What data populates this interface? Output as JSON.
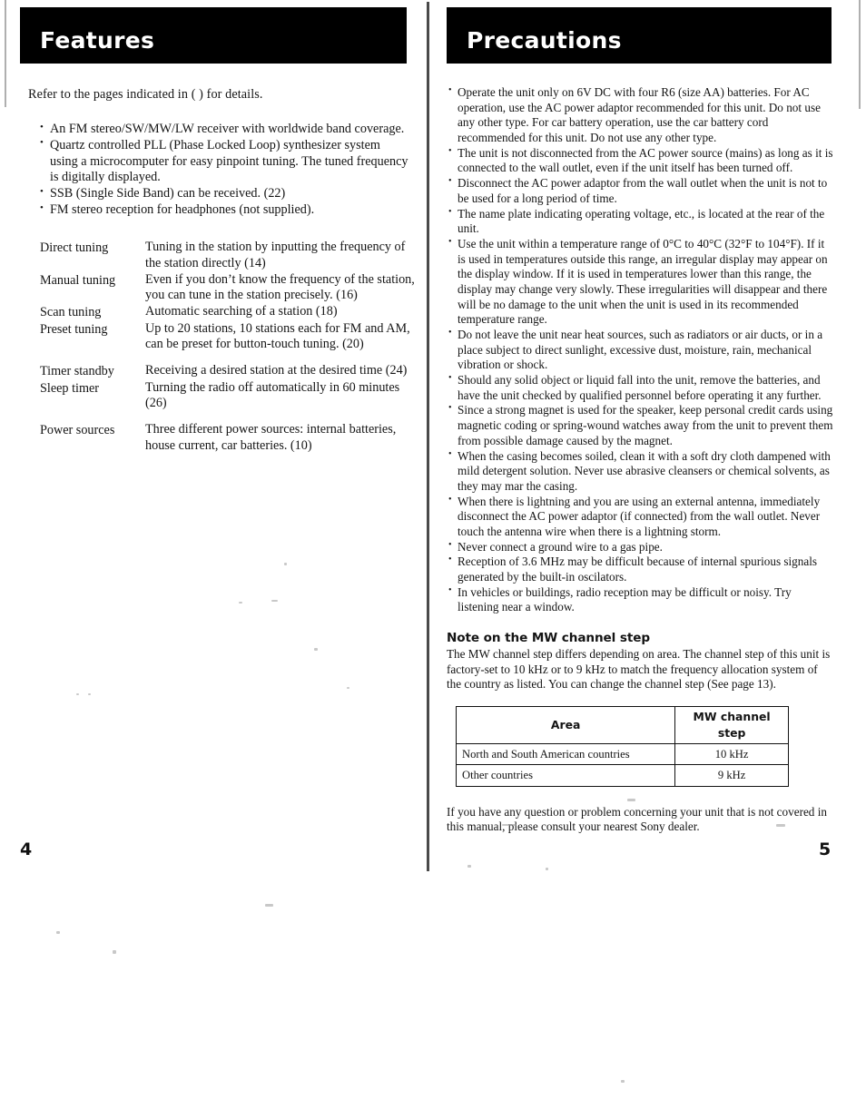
{
  "document": {
    "left_page_number": "4",
    "right_page_number": "5"
  },
  "left_column": {
    "section_title": "Features",
    "intro": "Refer to the pages indicated in ( ) for details.",
    "feature_bullets": [
      "An FM stereo/SW/MW/LW receiver with worldwide band coverage.",
      "Quartz controlled PLL (Phase Locked Loop) synthesizer system using a microcomputer for easy pinpoint tuning.  The tuned frequency is digitally displayed.",
      "SSB (Single Side Band) can be received. (22)",
      "FM stereo reception for headphones (not supplied)."
    ],
    "definitions": [
      {
        "term": "Direct tuning",
        "desc": "Tuning in the station by inputting the frequency of the station directly (14)"
      },
      {
        "term": "Manual tuning",
        "desc": "Even if you don’t know the frequency of the station, you can tune in the station precisely. (16)"
      },
      {
        "term": "Scan tuning",
        "desc": "Automatic searching of a station (18)"
      },
      {
        "term": "Preset tuning",
        "desc": "Up to 20 stations, 10 stations each for FM and AM, can be preset for button-touch tuning. (20)"
      },
      {
        "term": "Timer standby",
        "desc": "Receiving a desired station at the desired time (24)"
      },
      {
        "term": "Sleep timer",
        "desc": "Turning the radio off automatically in 60 minutes (26)"
      },
      {
        "term": "Power sources",
        "desc": "Three different power sources: internal batteries, house current, car batteries. (10)"
      }
    ]
  },
  "right_column": {
    "section_title": "Precautions",
    "precaution_bullets": [
      "Operate the unit only on 6V DC with four R6 (size AA) batteries. For AC operation, use the AC power adaptor recommended for this unit. Do not use any other type. For car battery operation, use the car battery cord recommended for this unit.  Do not use any other type.",
      "The unit is not disconnected from the AC power source (mains) as long as it is connected to the wall outlet, even if the unit itself has been turned off.",
      "Disconnect the AC power adaptor from the wall outlet when the unit is not to be used for a long period of time.",
      "The name plate indicating operating voltage, etc., is located at the rear of the unit.",
      "Use the unit within a temperature range of 0°C to 40°C (32°F to 104°F).  If it is used in temperatures outside this range, an irregular display may appear on the display window.  If it is used in temperatures lower than this range, the display may change very slowly.  These irregularities will disappear and there will be no damage to the unit when the unit is used in its recommended temperature range.",
      "Do not leave the unit near heat sources, such as radiators or air ducts, or in a place subject to direct sunlight, excessive dust, moisture, rain, mechanical vibration or shock.",
      "Should any solid object or liquid fall into the unit, remove the batteries, and have the unit checked by qualified personnel before operating it any further.",
      "Since a strong magnet is used for the speaker, keep personal credit cards using magnetic coding or spring-wound watches away from the unit to prevent them from possible damage caused by the magnet.",
      "When the casing becomes soiled, clean it with a soft dry cloth dampened with mild detergent solution.  Never use abrasive cleansers or chemical solvents, as they may mar the casing.",
      "When there is lightning and you are using an external antenna, immediately disconnect the AC power adaptor (if connected) from the wall outlet.  Never touch the antenna wire when there is a lightning storm.",
      "Never connect a ground wire to a gas pipe.",
      "Reception of 3.6 MHz may be difficult because of internal spurious signals generated by the built-in oscilators.",
      "In vehicles or buildings, radio reception may be difficult or noisy.  Try listening near a window."
    ],
    "note_heading": "Note on the MW channel step",
    "note_paragraph": "The MW channel step differs depending on area.  The channel step of this unit is factory-set to 10 kHz or to 9 kHz to match the frequency allocation system of the country as listed.  You can change the channel step (See page 13).",
    "mw_table": {
      "headers": [
        "Area",
        "MW channel step"
      ],
      "rows": [
        [
          "North and South American countries",
          "10 kHz"
        ],
        [
          "Other countries",
          "9 kHz"
        ]
      ]
    },
    "closing_paragraph": "If you have any question or problem concerning your unit that is not covered in this manual, please consult your nearest Sony dealer."
  }
}
